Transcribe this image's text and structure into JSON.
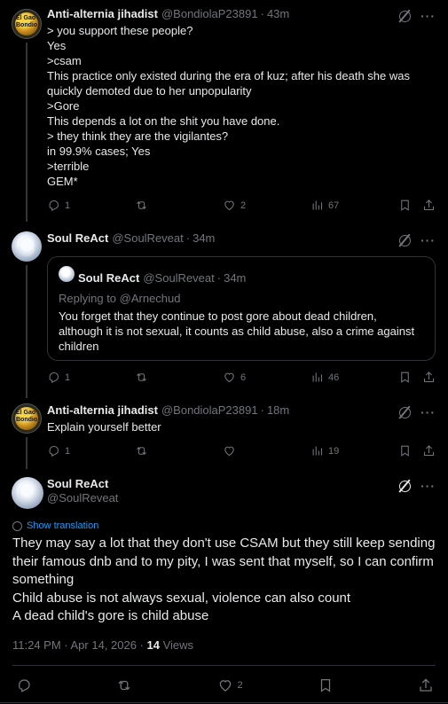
{
  "post1": {
    "name": "Anti-alternia jihadist",
    "handle": "@BondiolaP23891",
    "time": "43m",
    "avatar_text": "El Gao Bondio",
    "lines": [
      "> you support these people?",
      "Yes",
      ">csam",
      "This practice only existed during the era of kuz; after his death she was",
      "quickly demoted due to her unpopularity",
      ">Gore",
      "This depends a lot on the shit you have done.",
      "> they think they are the vigilantes?",
      "in 99.9% cases; Yes",
      ">terrible",
      "GEM*"
    ],
    "replies": "1",
    "retweets": "",
    "likes": "2",
    "views": "67"
  },
  "post2": {
    "name": "Soul ReAct",
    "handle": "@SoulReveat",
    "time": "34m",
    "quote": {
      "name": "Soul ReAct",
      "handle": "@SoulReveat",
      "time": "34m",
      "replying_to": "Replying to @Arnechud",
      "lines": [
        "You forget that they continue to post gore about dead children,",
        "although it is not sexual, it counts as child abuse, also a crime against",
        "children"
      ]
    },
    "replies": "1",
    "retweets": "",
    "likes": "6",
    "views": "46"
  },
  "post3": {
    "name": "Anti-alternia jihadist",
    "handle": "@BondiolaP23891",
    "time": "18m",
    "avatar_text": "El Gao Bondio",
    "text": "Explain yourself better",
    "replies": "1",
    "retweets": "",
    "likes": "",
    "views": "19"
  },
  "main": {
    "name": "Soul ReAct",
    "handle": "@SoulReveat",
    "show_translation": "Show translation",
    "paragraphs": [
      "They may say a lot that they don't use CSAM but they still keep sending",
      "their famous dnb and to my pity, I was sent that myself, so I can confirm",
      "something",
      "Child abuse is not always sexual, violence can also count",
      "A dead child's gore is child abuse"
    ],
    "timestamp": "11:24 PM · Apr 14, 2026 · ",
    "views_count": "14",
    "views_label": " Views",
    "replies": "",
    "retweets": "",
    "likes": "2"
  },
  "colors": {
    "background": "#000000",
    "text": "#e7e9ea",
    "muted": "#71767b",
    "link": "#1d9bf0",
    "border": "#2f3336"
  }
}
